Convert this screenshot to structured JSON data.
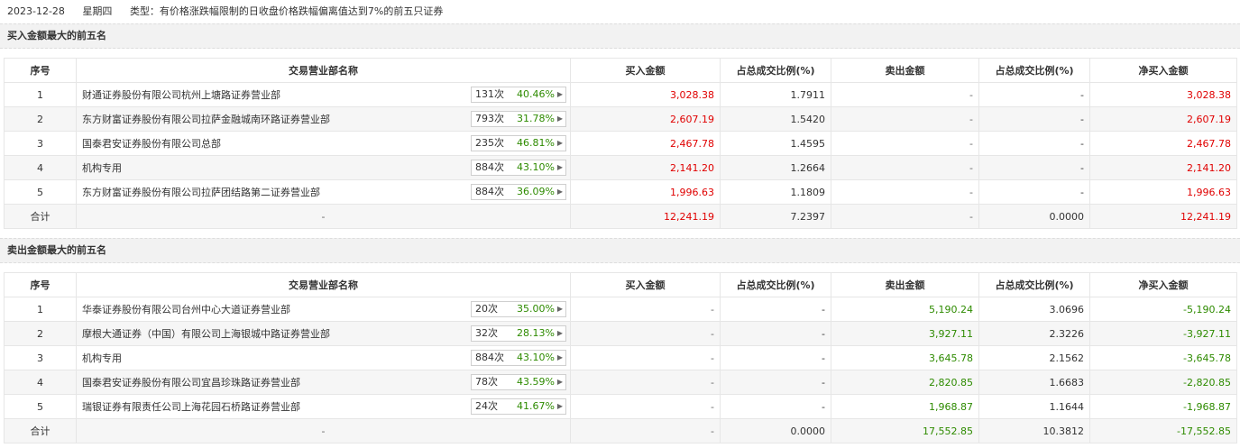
{
  "topline": {
    "date": "2023-12-28",
    "weekday": "星期四",
    "type_text": "类型：有价格涨跌幅限制的日收盘价格跌幅偏离值达到7%的前五只证券"
  },
  "headers": [
    "序号",
    "交易营业部名称",
    "买入金额",
    "占总成交比例(%)",
    "卖出金额",
    "占总成交比例(%)",
    "净买入金额"
  ],
  "buy": {
    "title": "买入金额最大的前五名",
    "rows": [
      {
        "idx": "1",
        "name": "财通证券股份有限公司杭州上塘路证券营业部",
        "count": "131次",
        "pct": "40.46%",
        "buy": "3,028.38",
        "buy_ratio": "1.7911",
        "sell": "-",
        "sell_ratio": "-",
        "net": "3,028.38"
      },
      {
        "idx": "2",
        "name": "东方财富证券股份有限公司拉萨金融城南环路证券营业部",
        "count": "793次",
        "pct": "31.78%",
        "buy": "2,607.19",
        "buy_ratio": "1.5420",
        "sell": "-",
        "sell_ratio": "-",
        "net": "2,607.19"
      },
      {
        "idx": "3",
        "name": "国泰君安证券股份有限公司总部",
        "count": "235次",
        "pct": "46.81%",
        "buy": "2,467.78",
        "buy_ratio": "1.4595",
        "sell": "-",
        "sell_ratio": "-",
        "net": "2,467.78"
      },
      {
        "idx": "4",
        "name": "机构专用",
        "count": "884次",
        "pct": "43.10%",
        "buy": "2,141.20",
        "buy_ratio": "1.2664",
        "sell": "-",
        "sell_ratio": "-",
        "net": "2,141.20"
      },
      {
        "idx": "5",
        "name": "东方财富证券股份有限公司拉萨团结路第二证券营业部",
        "count": "884次",
        "pct": "36.09%",
        "buy": "1,996.63",
        "buy_ratio": "1.1809",
        "sell": "-",
        "sell_ratio": "-",
        "net": "1,996.63"
      }
    ],
    "total": {
      "label": "合计",
      "name": "-",
      "buy": "12,241.19",
      "buy_ratio": "7.2397",
      "sell": "-",
      "sell_ratio": "0.0000",
      "net": "12,241.19"
    }
  },
  "sell": {
    "title": "卖出金额最大的前五名",
    "rows": [
      {
        "idx": "1",
        "name": "华泰证券股份有限公司台州中心大道证券营业部",
        "count": "20次",
        "pct": "35.00%",
        "buy": "-",
        "buy_ratio": "-",
        "sell": "5,190.24",
        "sell_ratio": "3.0696",
        "net": "-5,190.24"
      },
      {
        "idx": "2",
        "name": "摩根大通证券（中国）有限公司上海银城中路证券营业部",
        "count": "32次",
        "pct": "28.13%",
        "buy": "-",
        "buy_ratio": "-",
        "sell": "3,927.11",
        "sell_ratio": "2.3226",
        "net": "-3,927.11"
      },
      {
        "idx": "3",
        "name": "机构专用",
        "count": "884次",
        "pct": "43.10%",
        "buy": "-",
        "buy_ratio": "-",
        "sell": "3,645.78",
        "sell_ratio": "2.1562",
        "net": "-3,645.78"
      },
      {
        "idx": "4",
        "name": "国泰君安证券股份有限公司宜昌珍珠路证券营业部",
        "count": "78次",
        "pct": "43.59%",
        "buy": "-",
        "buy_ratio": "-",
        "sell": "2,820.85",
        "sell_ratio": "1.6683",
        "net": "-2,820.85"
      },
      {
        "idx": "5",
        "name": "瑞银证券有限责任公司上海花园石桥路证券营业部",
        "count": "24次",
        "pct": "41.67%",
        "buy": "-",
        "buy_ratio": "-",
        "sell": "1,968.87",
        "sell_ratio": "1.1644",
        "net": "-1,968.87"
      }
    ],
    "total": {
      "label": "合计",
      "name": "-",
      "buy": "-",
      "buy_ratio": "0.0000",
      "sell": "17,552.85",
      "sell_ratio": "10.3812",
      "net": "-17,552.85"
    }
  }
}
